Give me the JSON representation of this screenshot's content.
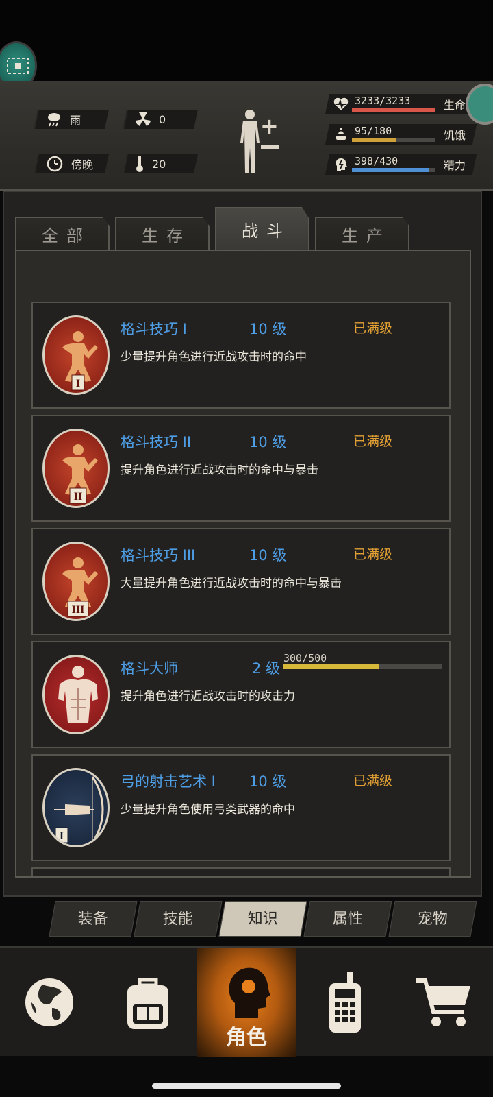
{
  "status": {
    "weather": "雨",
    "radiation": "0",
    "time_of_day": "傍晚",
    "temperature": "20"
  },
  "vitals": [
    {
      "name": "life",
      "value": "3233/3233",
      "label": "生命",
      "fraction": 1.0,
      "color": "#d9564a",
      "icon": "heart-pulse-icon"
    },
    {
      "name": "hunger",
      "value": "95/180",
      "label": "饥饿",
      "fraction": 0.53,
      "color": "#d0a13a",
      "icon": "food-icon"
    },
    {
      "name": "energy",
      "value": "398/430",
      "label": "精力",
      "fraction": 0.93,
      "color": "#4f8fd3",
      "icon": "energy-head-icon"
    }
  ],
  "tabs": [
    {
      "label": "全部",
      "active": false
    },
    {
      "label": "生存",
      "active": false
    },
    {
      "label": "战斗",
      "active": true
    },
    {
      "label": "生产",
      "active": false
    }
  ],
  "skills": [
    {
      "title": "格斗技巧 I",
      "level": "10 级",
      "status": "已满级",
      "desc": "少量提升角色进行近战攻击时的命中",
      "icon": "fighter-stance-icon",
      "numeral": "I"
    },
    {
      "title": "格斗技巧 II",
      "level": "10 级",
      "status": "已满级",
      "desc": "提升角色进行近战攻击时的命中与暴击",
      "icon": "fighter-stance-icon",
      "numeral": "II"
    },
    {
      "title": "格斗技巧 III",
      "level": "10 级",
      "status": "已满级",
      "desc": "大量提升角色进行近战攻击时的命中与暴击",
      "icon": "fighter-stance-icon",
      "numeral": "III"
    },
    {
      "title": "格斗大师",
      "level": "2 级",
      "status": "",
      "progress_text": "300/500",
      "progress": 0.6,
      "desc": "提升角色进行近战攻击时的攻击力",
      "icon": "muscle-torso-icon"
    },
    {
      "title": "弓的射击艺术 I",
      "level": "10 级",
      "status": "已满级",
      "desc": "少量提升角色使用弓类武器的命中",
      "icon": "archer-icon",
      "numeral": "I"
    }
  ],
  "subnav": [
    {
      "label": "装备",
      "active": false
    },
    {
      "label": "技能",
      "active": false
    },
    {
      "label": "知识",
      "active": true
    },
    {
      "label": "属性",
      "active": false
    },
    {
      "label": "宠物",
      "active": false
    }
  ],
  "bottomnav": [
    {
      "icon": "globe-icon",
      "label": ""
    },
    {
      "icon": "backpack-icon",
      "label": ""
    },
    {
      "icon": "character-head-icon",
      "label": "角色",
      "active": true
    },
    {
      "icon": "radio-icon",
      "label": ""
    },
    {
      "icon": "cart-icon",
      "label": ""
    }
  ]
}
